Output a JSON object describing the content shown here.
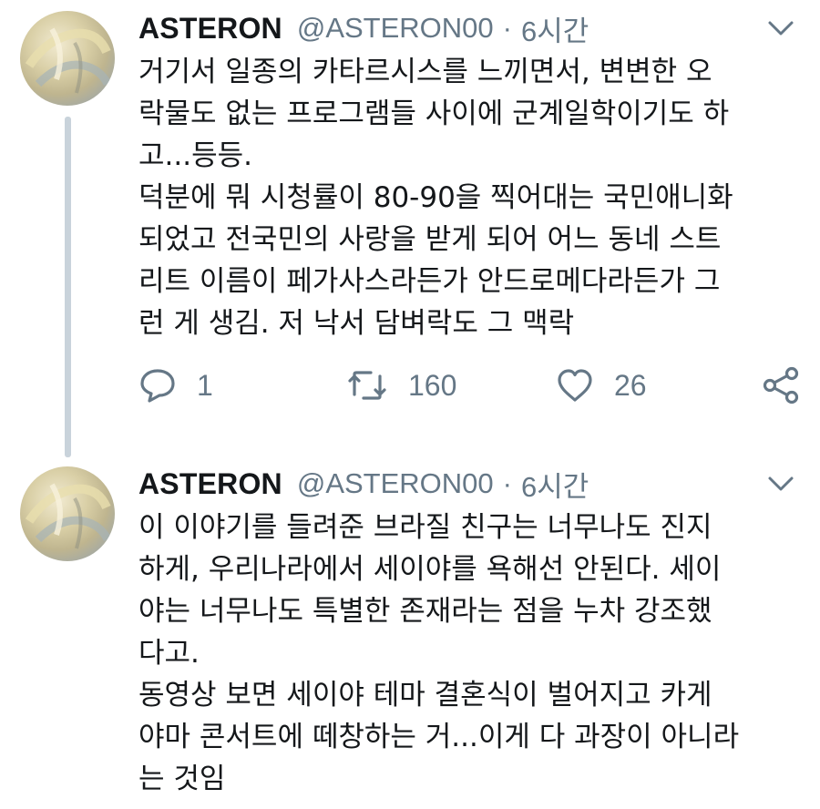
{
  "tweets": [
    {
      "display_name": "ASTERON",
      "handle": "@ASTERON00",
      "separator": "·",
      "time": "6시간",
      "lines": [
        "거기서 일종의 카타르시스를 느끼면서, 변변한 오",
        "락물도 없는 프로그램들 사이에 군계일학이기도 하",
        "고...등등.",
        "덕분에 뭐 시청률이 80-90을 찍어대는 국민애니화",
        "되었고 전국민의 사랑을 받게 되어 어느 동네 스트",
        "리트 이름이 페가사스라든가 안드로메다라든가 그",
        "런 게 생김. 저 낙서 담벼락도 그 맥락"
      ],
      "reply_count": "1",
      "retweet_count": "160",
      "like_count": "26"
    },
    {
      "display_name": "ASTERON",
      "handle": "@ASTERON00",
      "separator": "·",
      "time": "6시간",
      "lines": [
        "이 이야기를 들려준 브라질 친구는 너무나도 진지",
        "하게, 우리나라에서 세이야를 욕해선 안된다. 세이",
        "야는 너무나도 특별한 존재라는 점을 누차 강조했",
        "다고.",
        "동영상 보면 세이야 테마 결혼식이 벌어지고 카게",
        "야마 콘서트에 떼창하는 거...이게 다 과장이 아니라",
        "는 것임"
      ]
    }
  ],
  "icons": {
    "reply": "reply-icon",
    "retweet": "retweet-icon",
    "like": "heart-icon",
    "share": "share-icon",
    "menu": "chevron-down-icon"
  },
  "colors": {
    "text": "#14171a",
    "secondary": "#657786",
    "thread_line": "#c9d3db"
  }
}
